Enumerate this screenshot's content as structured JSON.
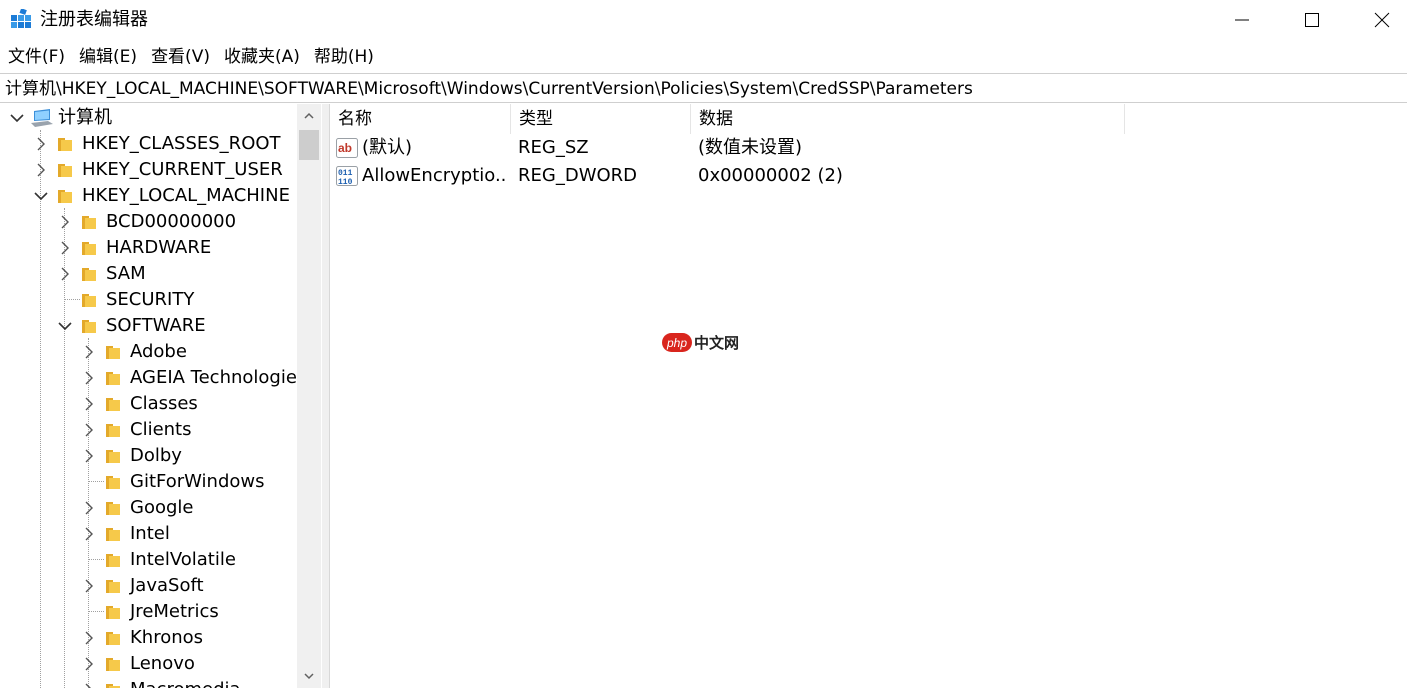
{
  "window": {
    "title": "注册表编辑器",
    "icon": "regedit-icon",
    "controls": [
      "minimize-icon",
      "maximize-icon",
      "close-icon"
    ]
  },
  "menu": [
    {
      "label": "文件(F)"
    },
    {
      "label": "编辑(E)"
    },
    {
      "label": "查看(V)"
    },
    {
      "label": "收藏夹(A)"
    },
    {
      "label": "帮助(H)"
    }
  ],
  "address": "计算机\\HKEY_LOCAL_MACHINE\\SOFTWARE\\Microsoft\\Windows\\CurrentVersion\\Policies\\System\\CredSSP\\Parameters",
  "tree": {
    "root": "计算机",
    "hives": [
      {
        "label": "HKEY_CLASSES_ROOT",
        "expanded": false
      },
      {
        "label": "HKEY_CURRENT_USER",
        "expanded": false
      },
      {
        "label": "HKEY_LOCAL_MACHINE",
        "expanded": true
      }
    ],
    "hklm_children": [
      {
        "label": "BCD00000000",
        "has_children": true,
        "expanded": false
      },
      {
        "label": "HARDWARE",
        "has_children": true,
        "expanded": false
      },
      {
        "label": "SAM",
        "has_children": true,
        "expanded": false
      },
      {
        "label": "SECURITY",
        "has_children": false,
        "expanded": false
      },
      {
        "label": "SOFTWARE",
        "has_children": true,
        "expanded": true
      }
    ],
    "software_children": [
      {
        "label": "Adobe",
        "has_children": true
      },
      {
        "label": "AGEIA Technologies",
        "has_children": true
      },
      {
        "label": "Classes",
        "has_children": true
      },
      {
        "label": "Clients",
        "has_children": true
      },
      {
        "label": "Dolby",
        "has_children": true
      },
      {
        "label": "GitForWindows",
        "has_children": false
      },
      {
        "label": "Google",
        "has_children": true
      },
      {
        "label": "Intel",
        "has_children": true
      },
      {
        "label": "IntelVolatile",
        "has_children": false
      },
      {
        "label": "JavaSoft",
        "has_children": true
      },
      {
        "label": "JreMetrics",
        "has_children": false
      },
      {
        "label": "Khronos",
        "has_children": true
      },
      {
        "label": "Lenovo",
        "has_children": true
      },
      {
        "label": "Macromedia",
        "has_children": true
      }
    ]
  },
  "list": {
    "columns": [
      "名称",
      "类型",
      "数据"
    ],
    "rows": [
      {
        "icon": "string-value-icon",
        "name": "(默认)",
        "type": "REG_SZ",
        "data": "(数值未设置)"
      },
      {
        "icon": "binary-value-icon",
        "name": "AllowEncryptio...",
        "type": "REG_DWORD",
        "data": "0x00000002 (2)"
      }
    ]
  },
  "watermark": {
    "badge": "php",
    "text": "中文网"
  },
  "colors": {
    "folder": "#f6c94a",
    "folder_dark": "#e3a92a",
    "accent": "#0078d7",
    "watermark_red": "#d9251d"
  }
}
